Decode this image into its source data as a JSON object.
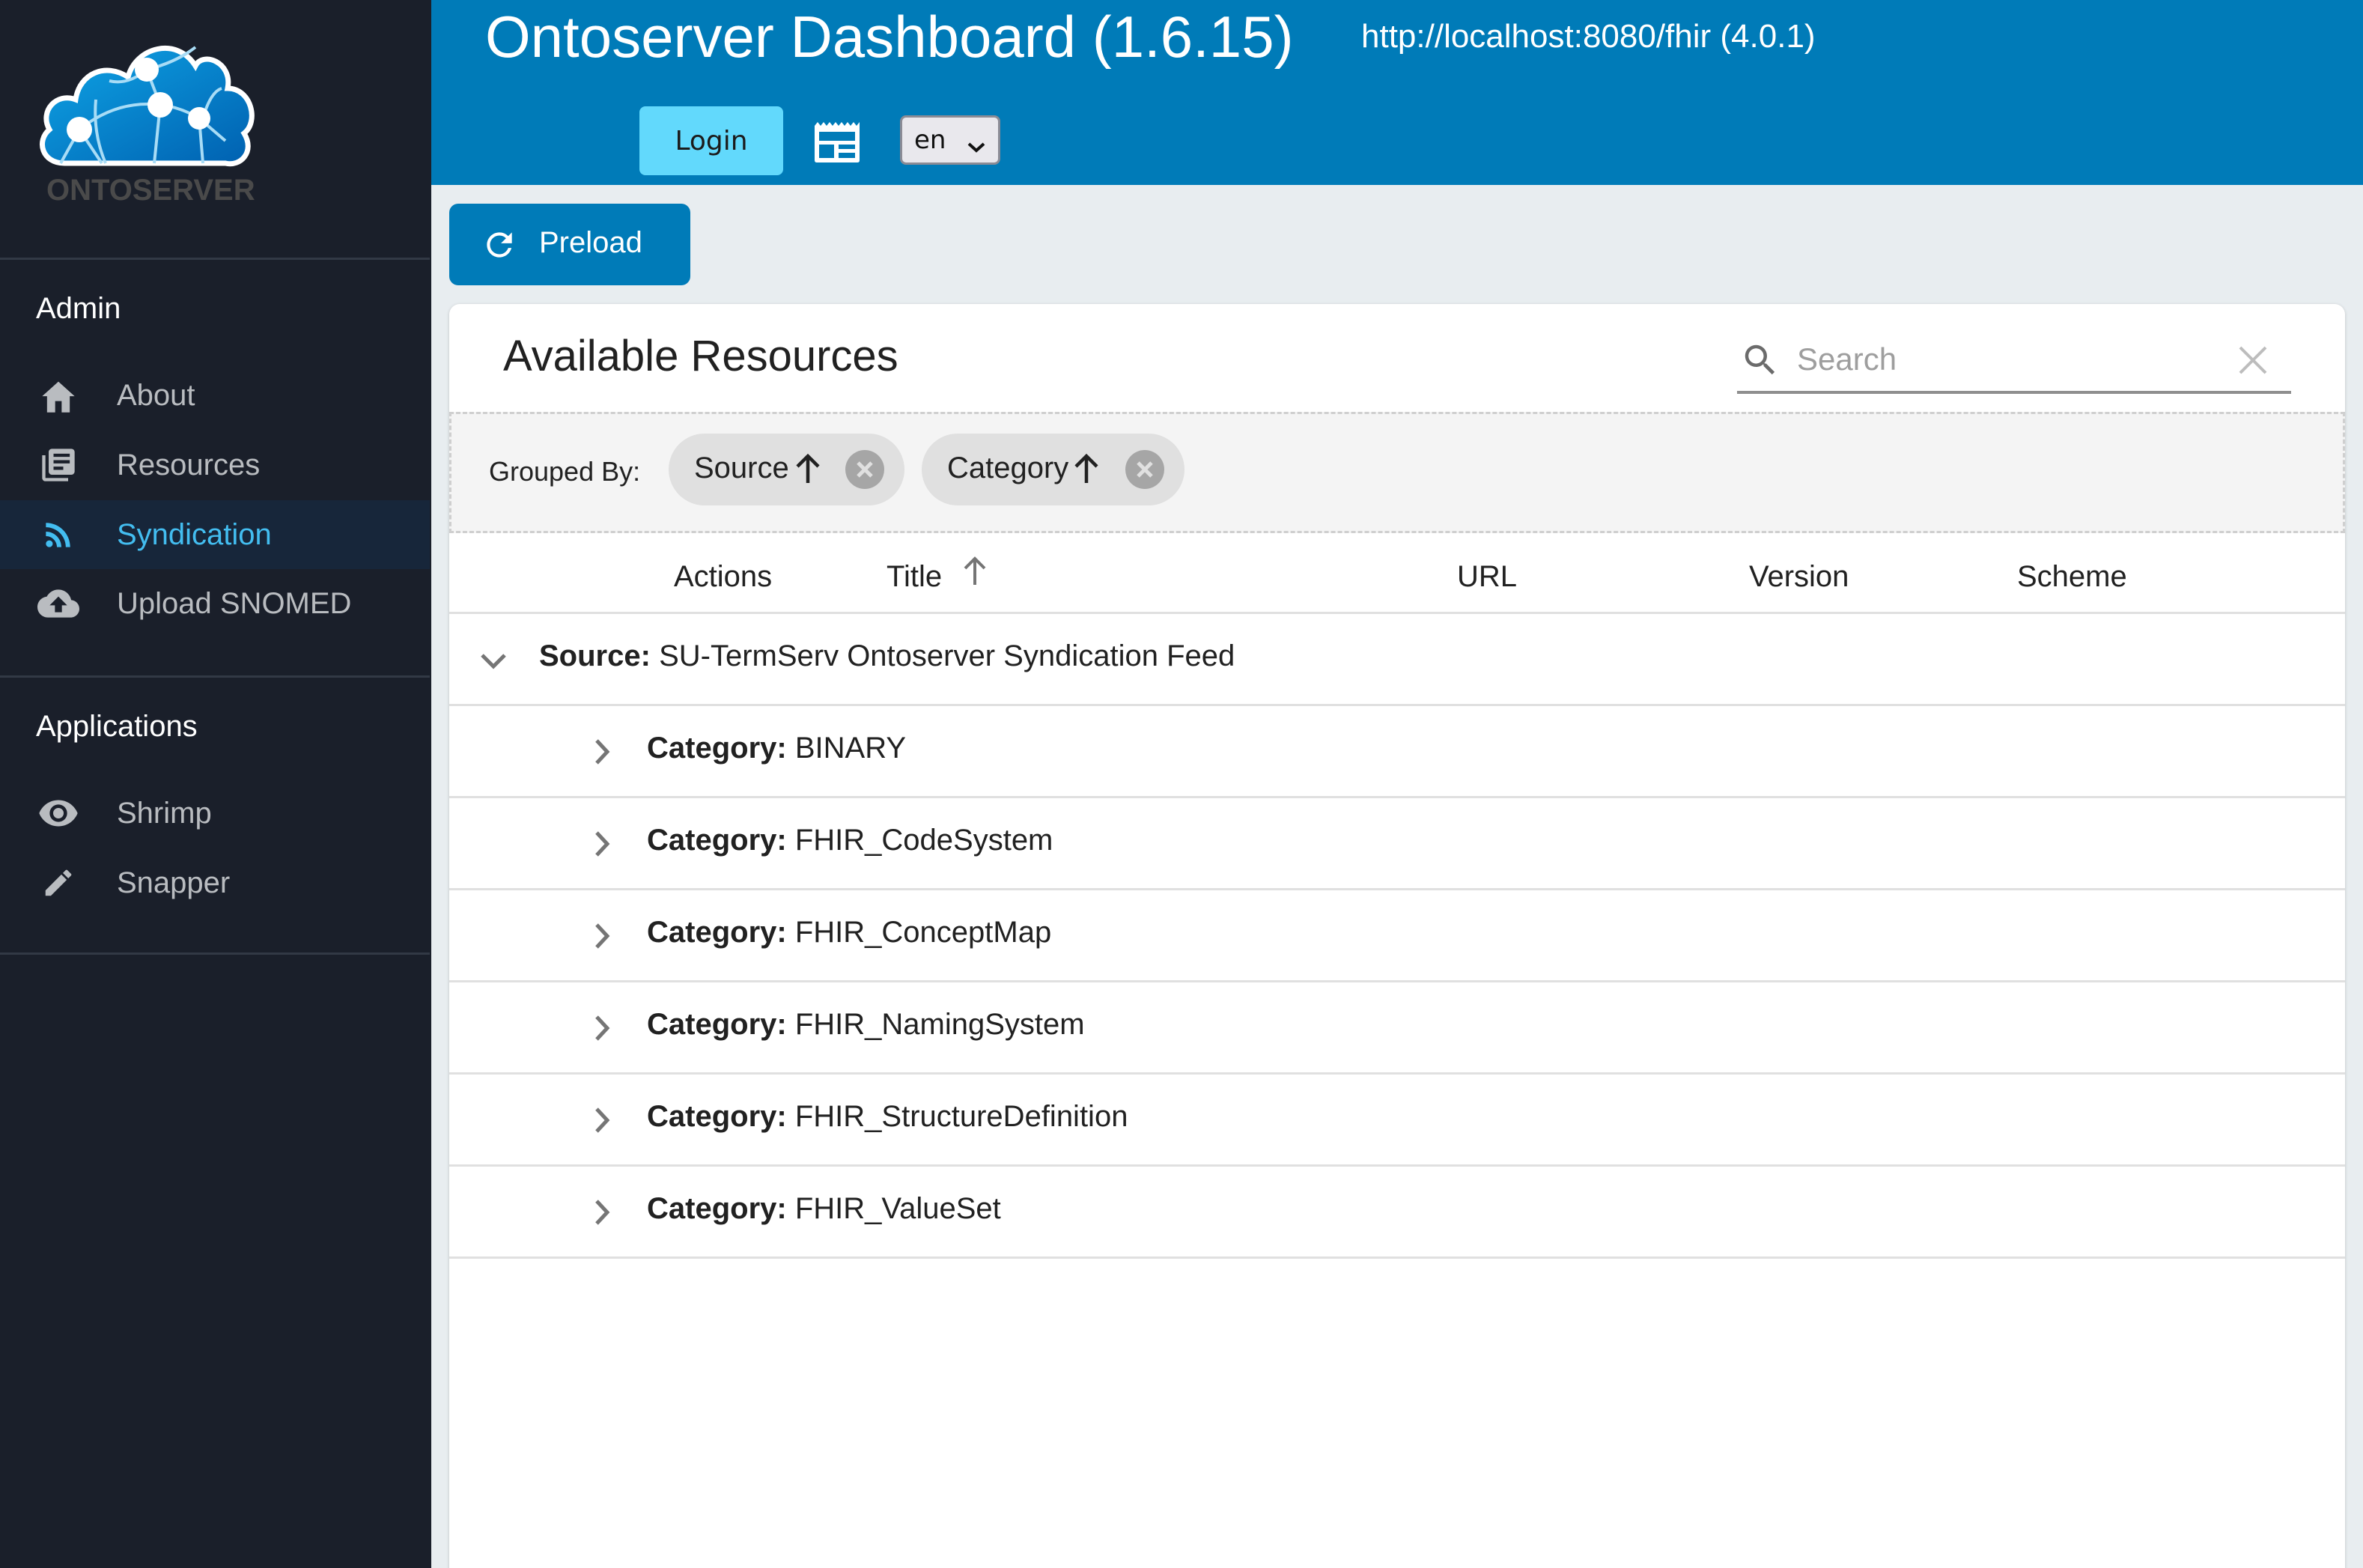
{
  "sidebar": {
    "logo_text": "ONTOSERVER",
    "sections": [
      {
        "heading": "Admin",
        "items": [
          {
            "label": "About",
            "icon": "home-icon",
            "active": false
          },
          {
            "label": "Resources",
            "icon": "library-books-icon",
            "active": false
          },
          {
            "label": "Syndication",
            "icon": "rss-feed-icon",
            "active": true
          },
          {
            "label": "Upload SNOMED",
            "icon": "cloud-upload-icon",
            "active": false
          }
        ]
      },
      {
        "heading": "Applications",
        "items": [
          {
            "label": "Shrimp",
            "icon": "eye-icon",
            "active": false
          },
          {
            "label": "Snapper",
            "icon": "pencil-icon",
            "active": false
          }
        ]
      }
    ]
  },
  "header": {
    "title": "Ontoserver Dashboard (1.6.15)",
    "server_url": "http://localhost:8080/fhir (4.0.1)",
    "login_label": "Login",
    "layout_icon": "web-layout-icon",
    "language": "en"
  },
  "toolbar": {
    "preload_label": "Preload",
    "preload_icon": "refresh-icon"
  },
  "resources": {
    "title": "Available Resources",
    "search": {
      "placeholder": "Search",
      "value": ""
    },
    "grouped_by_label": "Grouped By:",
    "groups": [
      {
        "label": "Source",
        "sort": "ascending"
      },
      {
        "label": "Category",
        "sort": "ascending"
      }
    ],
    "columns": [
      {
        "label": "Actions",
        "sorted": false
      },
      {
        "label": "Title",
        "sorted": "ascending"
      },
      {
        "label": "URL",
        "sorted": false
      },
      {
        "label": "Version",
        "sorted": false
      },
      {
        "label": "Scheme",
        "sorted": false
      }
    ],
    "source_group": {
      "key": "Source:",
      "value": "SU-TermServ Ontoserver Syndication Feed",
      "expanded": true
    },
    "category_groups": [
      {
        "key": "Category:",
        "value": "BINARY",
        "expanded": false
      },
      {
        "key": "Category:",
        "value": "FHIR_CodeSystem",
        "expanded": false
      },
      {
        "key": "Category:",
        "value": "FHIR_ConceptMap",
        "expanded": false
      },
      {
        "key": "Category:",
        "value": "FHIR_NamingSystem",
        "expanded": false
      },
      {
        "key": "Category:",
        "value": "FHIR_StructureDefinition",
        "expanded": false
      },
      {
        "key": "Category:",
        "value": "FHIR_ValueSet",
        "expanded": false
      }
    ]
  },
  "colors": {
    "sidebar_bg": "#1a1f2a",
    "header_bg": "#007bb8",
    "accent_active": "#43bdf0",
    "login_bg": "#62d9fc",
    "page_bg": "#e8edf0"
  }
}
